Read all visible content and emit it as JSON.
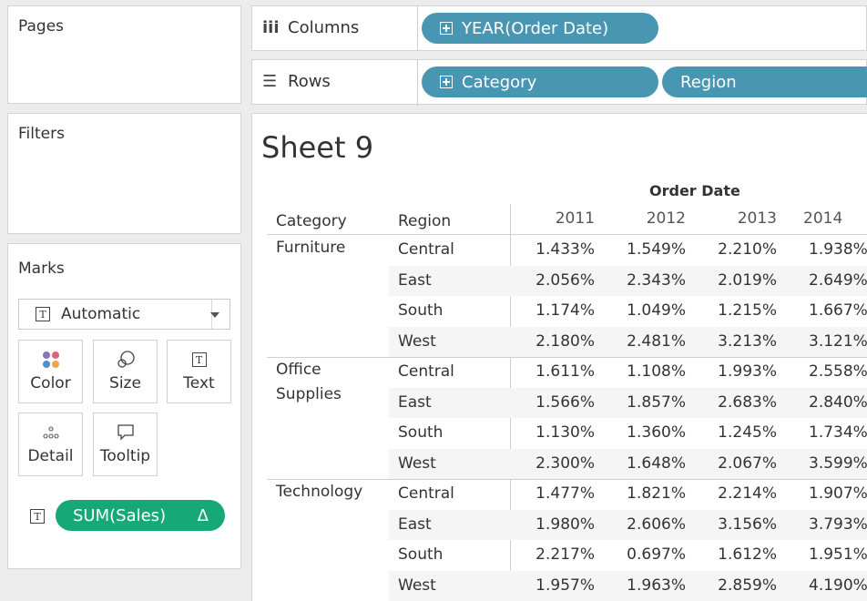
{
  "pages": {
    "title": "Pages"
  },
  "filters": {
    "title": "Filters"
  },
  "marks": {
    "title": "Marks",
    "mark_type": "Automatic",
    "buttons": [
      {
        "label": "Color",
        "icon": "color-dots-icon"
      },
      {
        "label": "Size",
        "icon": "size-icon"
      },
      {
        "label": "Text",
        "icon": "text-icon"
      },
      {
        "label": "Detail",
        "icon": "detail-icon"
      },
      {
        "label": "Tooltip",
        "icon": "tooltip-icon"
      }
    ],
    "field_pill": "SUM(Sales)",
    "field_pill_delta": "Δ"
  },
  "shelves": {
    "columns_label": "Columns",
    "rows_label": "Rows",
    "columns_pills": [
      "YEAR(Order Date)"
    ],
    "rows_pills": [
      "Category",
      "Region"
    ]
  },
  "sheet": {
    "title": "Sheet 9",
    "column_group_header": "Order Date",
    "row_headers": [
      "Category",
      "Region"
    ],
    "years": [
      "2011",
      "2012",
      "2013",
      "2014"
    ],
    "rows": [
      {
        "category": "Furniture",
        "region": "Central",
        "values": [
          "1.433%",
          "1.549%",
          "2.210%",
          "1.938%"
        ]
      },
      {
        "category": "",
        "region": "East",
        "values": [
          "2.056%",
          "2.343%",
          "2.019%",
          "2.649%"
        ]
      },
      {
        "category": "",
        "region": "South",
        "values": [
          "1.174%",
          "1.049%",
          "1.215%",
          "1.667%"
        ]
      },
      {
        "category": "",
        "region": "West",
        "values": [
          "2.180%",
          "2.481%",
          "3.213%",
          "3.121%"
        ]
      },
      {
        "category": "Office",
        "region": "Central",
        "values": [
          "1.611%",
          "1.108%",
          "1.993%",
          "2.558%"
        ]
      },
      {
        "category": "Supplies",
        "region": "East",
        "values": [
          "1.566%",
          "1.857%",
          "2.683%",
          "2.840%"
        ]
      },
      {
        "category": "",
        "region": "South",
        "values": [
          "1.130%",
          "1.360%",
          "1.245%",
          "1.734%"
        ]
      },
      {
        "category": "",
        "region": "West",
        "values": [
          "2.300%",
          "1.648%",
          "2.067%",
          "3.599%"
        ]
      },
      {
        "category": "Technology",
        "region": "Central",
        "values": [
          "1.477%",
          "1.821%",
          "2.214%",
          "1.907%"
        ]
      },
      {
        "category": "",
        "region": "East",
        "values": [
          "1.980%",
          "2.606%",
          "3.156%",
          "3.793%"
        ]
      },
      {
        "category": "",
        "region": "South",
        "values": [
          "2.217%",
          "0.697%",
          "1.612%",
          "1.951%"
        ]
      },
      {
        "category": "",
        "region": "West",
        "values": [
          "1.957%",
          "1.963%",
          "2.859%",
          "4.190%"
        ]
      }
    ]
  },
  "colors": {
    "dimension_pill": "#4996b2",
    "measure_pill": "#17a878"
  }
}
